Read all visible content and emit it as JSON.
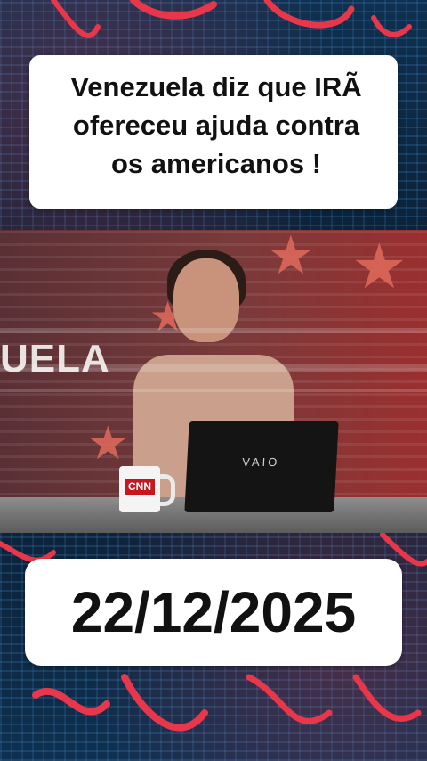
{
  "headline": "Venezuela diz que IRÃ\nofereceu ajuda contra\n os americanos !",
  "date": "22/12/2025",
  "video": {
    "set_wall_text": "UELA",
    "laptop_brand": "VAIO",
    "mug_logo": "CNN"
  },
  "colors": {
    "background": "#0b2238",
    "accent_red": "#e8364a",
    "box": "#ffffff"
  }
}
